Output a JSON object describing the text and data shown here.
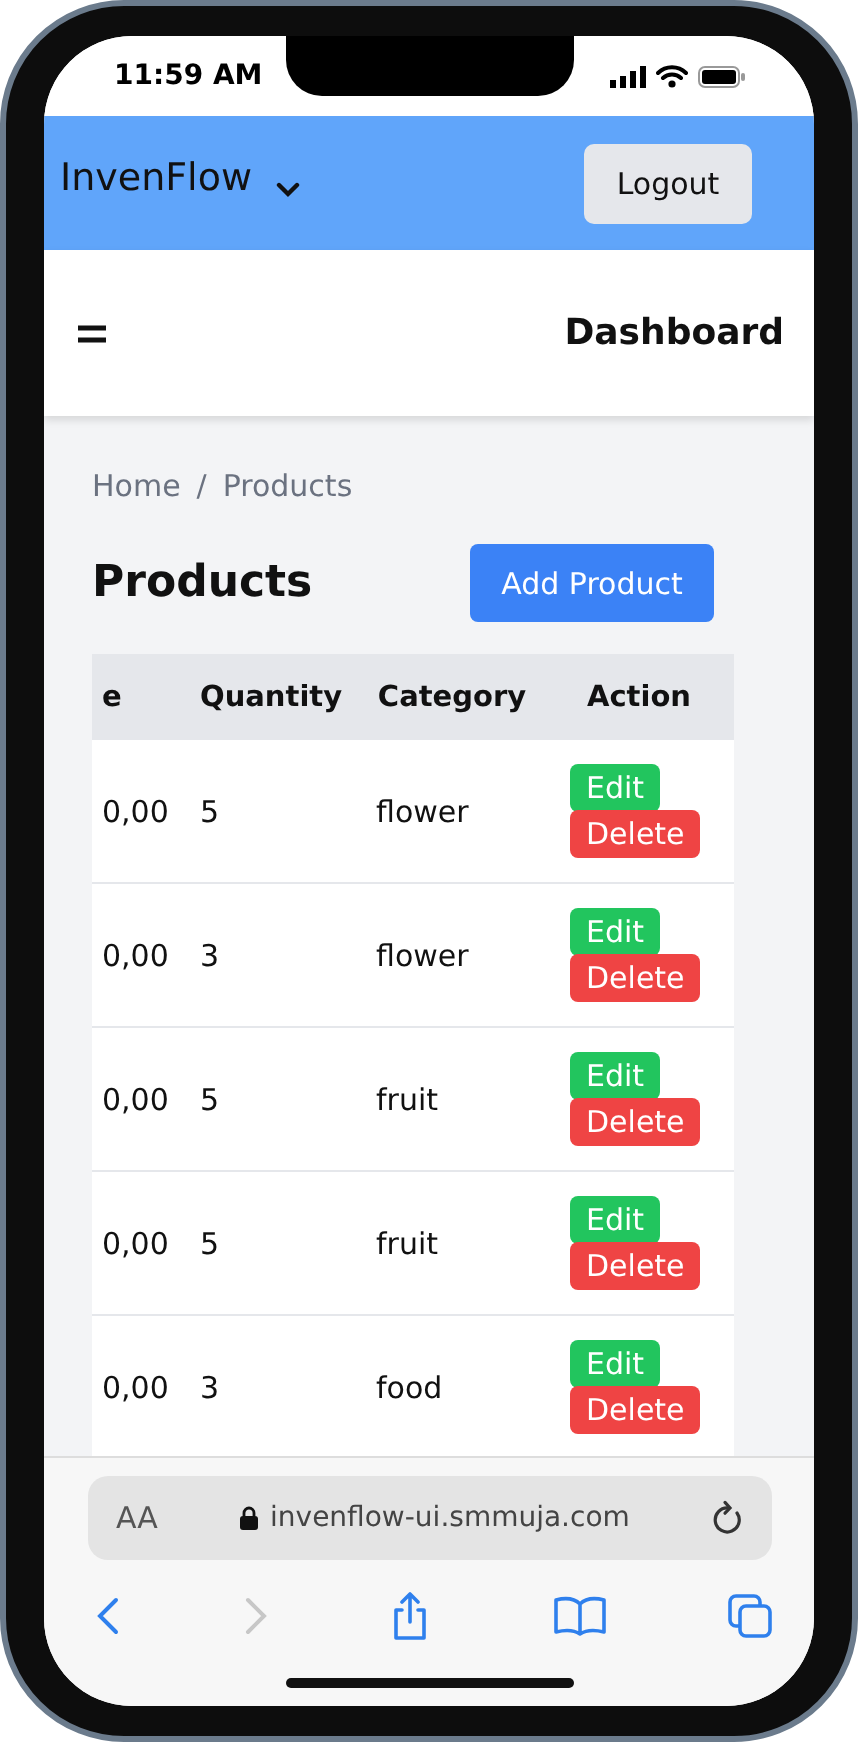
{
  "status_bar": {
    "time": "11:59 AM"
  },
  "header": {
    "brand": "InvenFlow",
    "logout": "Logout"
  },
  "topbar": {
    "title": "Dashboard"
  },
  "breadcrumb": {
    "items": [
      "Home",
      "Products"
    ],
    "separator": "/"
  },
  "page": {
    "title": "Products",
    "add_button": "Add Product"
  },
  "table": {
    "columns": [
      "e",
      "Quantity",
      "Category",
      "Action"
    ],
    "rows": [
      {
        "column_1": "0,00",
        "quantity": "5",
        "category": "flower",
        "actions": [
          {
            "label": "Edit",
            "kind": "edit"
          },
          {
            "label": "Delete",
            "kind": "delete"
          }
        ]
      },
      {
        "column_1": "0,00",
        "quantity": "3",
        "category": "flower",
        "actions": [
          {
            "label": "Edit",
            "kind": "edit"
          },
          {
            "label": "Delete",
            "kind": "delete"
          }
        ]
      },
      {
        "column_1": "0,00",
        "quantity": "5",
        "category": "fruit",
        "actions": [
          {
            "label": "Edit",
            "kind": "edit"
          },
          {
            "label": "Delete",
            "kind": "delete"
          }
        ]
      },
      {
        "column_1": "0,00",
        "quantity": "5",
        "category": "fruit",
        "actions": [
          {
            "label": "Edit",
            "kind": "edit"
          },
          {
            "label": "Delete",
            "kind": "delete"
          }
        ]
      },
      {
        "column_1": "0,00",
        "quantity": "3",
        "category": "food",
        "actions": [
          {
            "label": "Edit",
            "kind": "edit"
          },
          {
            "label": "Delete",
            "kind": "delete"
          }
        ]
      }
    ]
  },
  "browser": {
    "text_size": "AA",
    "url": "invenflow-ui.smmuja.com"
  }
}
